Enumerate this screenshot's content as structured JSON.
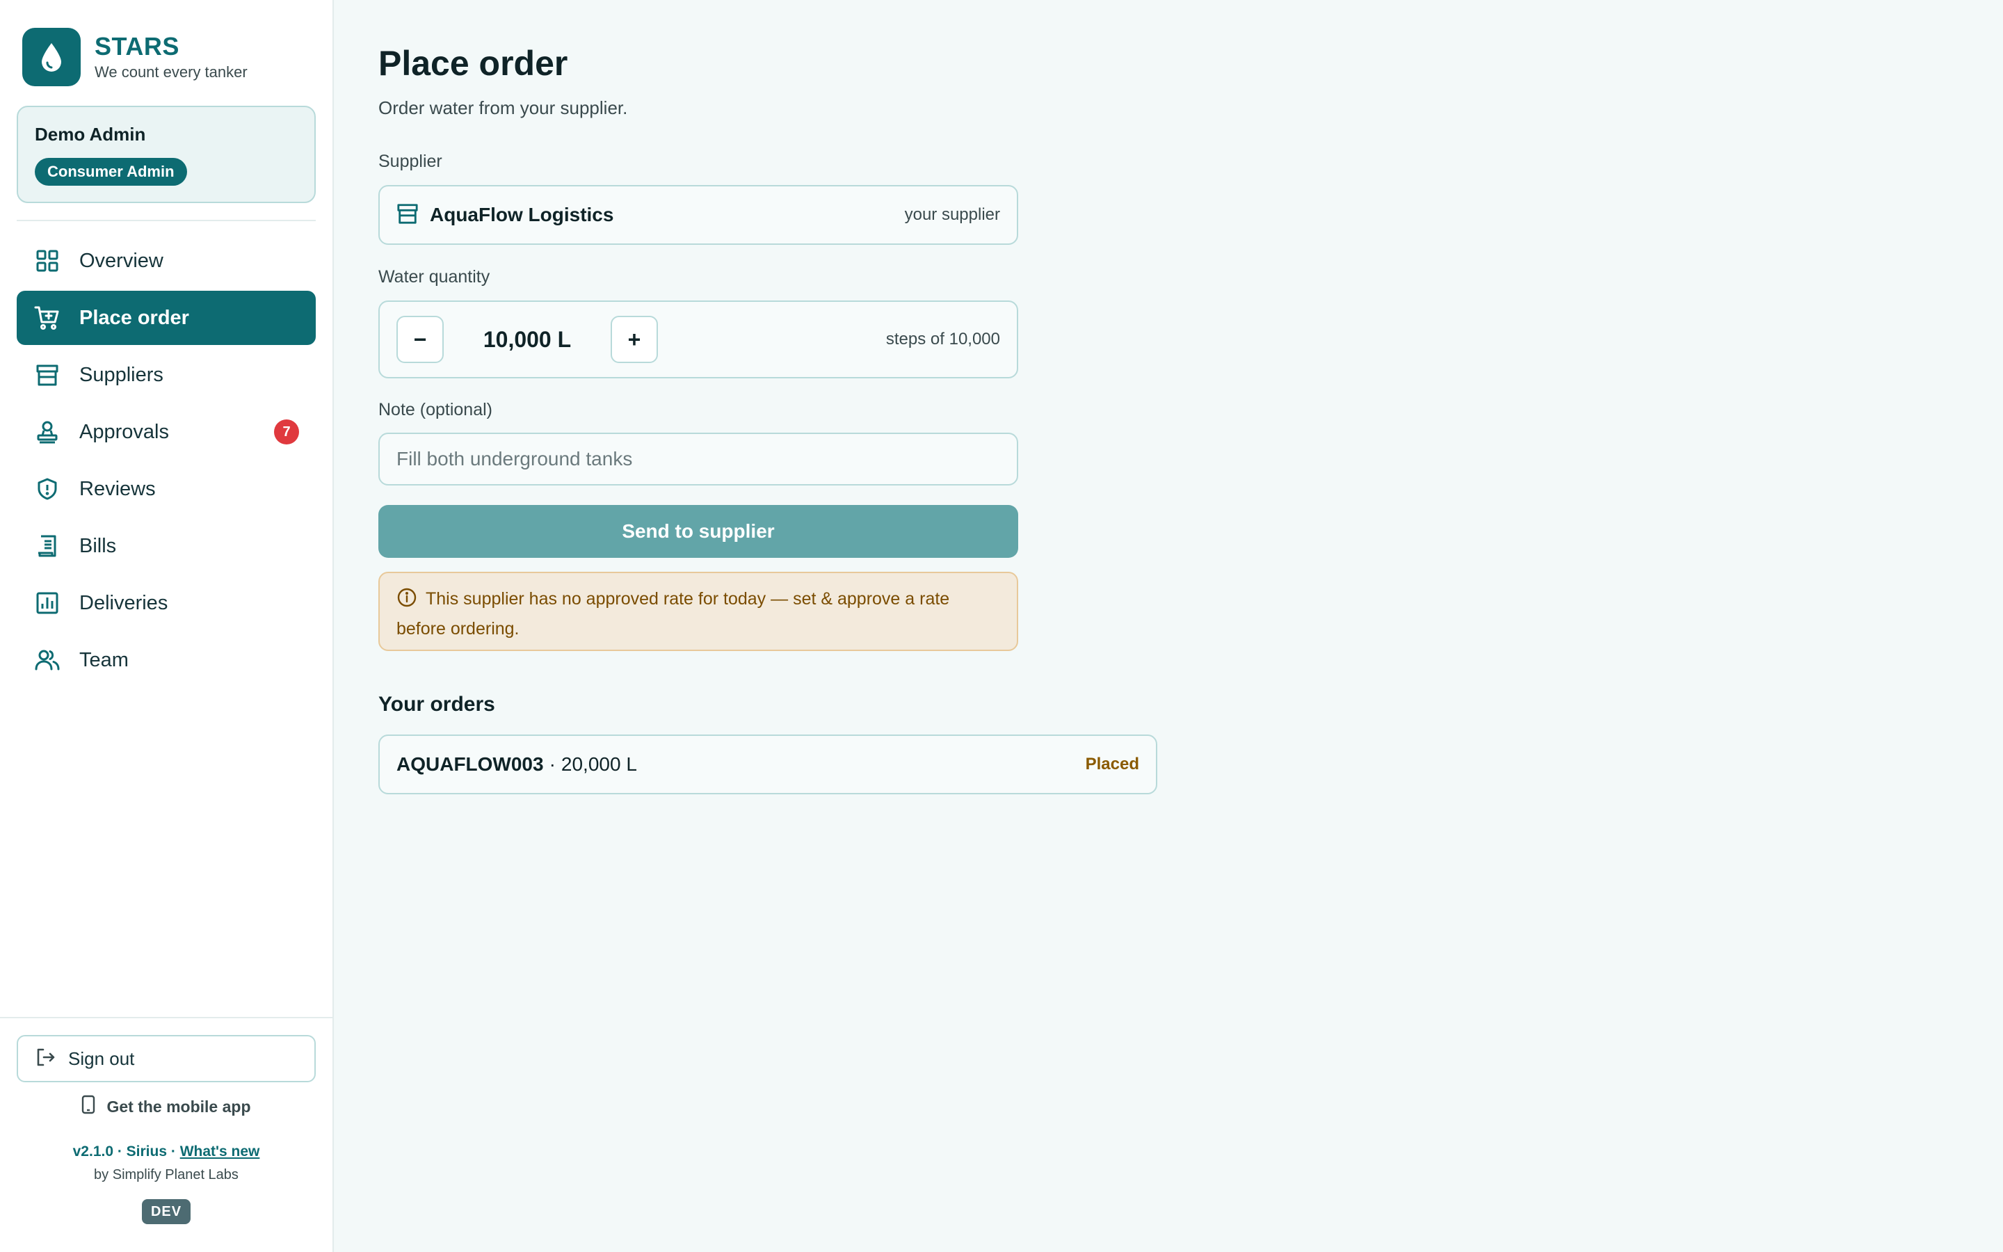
{
  "brand": {
    "name": "STARS",
    "tagline": "We count every tanker"
  },
  "user": {
    "name": "Demo Admin",
    "role": "Consumer Admin"
  },
  "nav": [
    {
      "label": "Overview",
      "icon": "grid-icon",
      "active": false
    },
    {
      "label": "Place order",
      "icon": "cart-icon",
      "active": true
    },
    {
      "label": "Suppliers",
      "icon": "store-icon",
      "active": false
    },
    {
      "label": "Approvals",
      "icon": "stamp-icon",
      "active": false,
      "badge": "7"
    },
    {
      "label": "Reviews",
      "icon": "shield-icon",
      "active": false
    },
    {
      "label": "Bills",
      "icon": "receipt-icon",
      "active": false
    },
    {
      "label": "Deliveries",
      "icon": "chart-icon",
      "active": false
    },
    {
      "label": "Team",
      "icon": "users-icon",
      "active": false
    }
  ],
  "footer": {
    "sign_out": "Sign out",
    "mobile_app": "Get the mobile app",
    "version": "v2.1.0 · Sirius · ",
    "whats_new": "What's new",
    "byline": "by Simplify Planet Labs",
    "env": "DEV"
  },
  "page": {
    "title": "Place order",
    "subtitle": "Order water from your supplier."
  },
  "form": {
    "supplier_label": "Supplier",
    "supplier_name": "AquaFlow Logistics",
    "supplier_hint": "your supplier",
    "quantity_label": "Water quantity",
    "quantity_value": "10,000 L",
    "quantity_hint": "steps of 10,000",
    "decrement": "−",
    "increment": "+",
    "note_label": "Note (optional)",
    "note_placeholder": "Fill both underground tanks",
    "note_value": "",
    "submit": "Send to supplier",
    "alert": "This supplier has no approved rate for today — set & approve a rate before ordering."
  },
  "orders": {
    "title": "Your orders",
    "items": [
      {
        "id": "AQUAFLOW003",
        "separator": "·",
        "quantity": "20,000 L",
        "status": "Placed"
      }
    ]
  },
  "colors": {
    "primary": "#0d6b72",
    "button_disabled": "#62a5a8",
    "badge": "#e0393e",
    "alert_bg": "#f3eadc",
    "alert_text": "#7a4c00"
  }
}
